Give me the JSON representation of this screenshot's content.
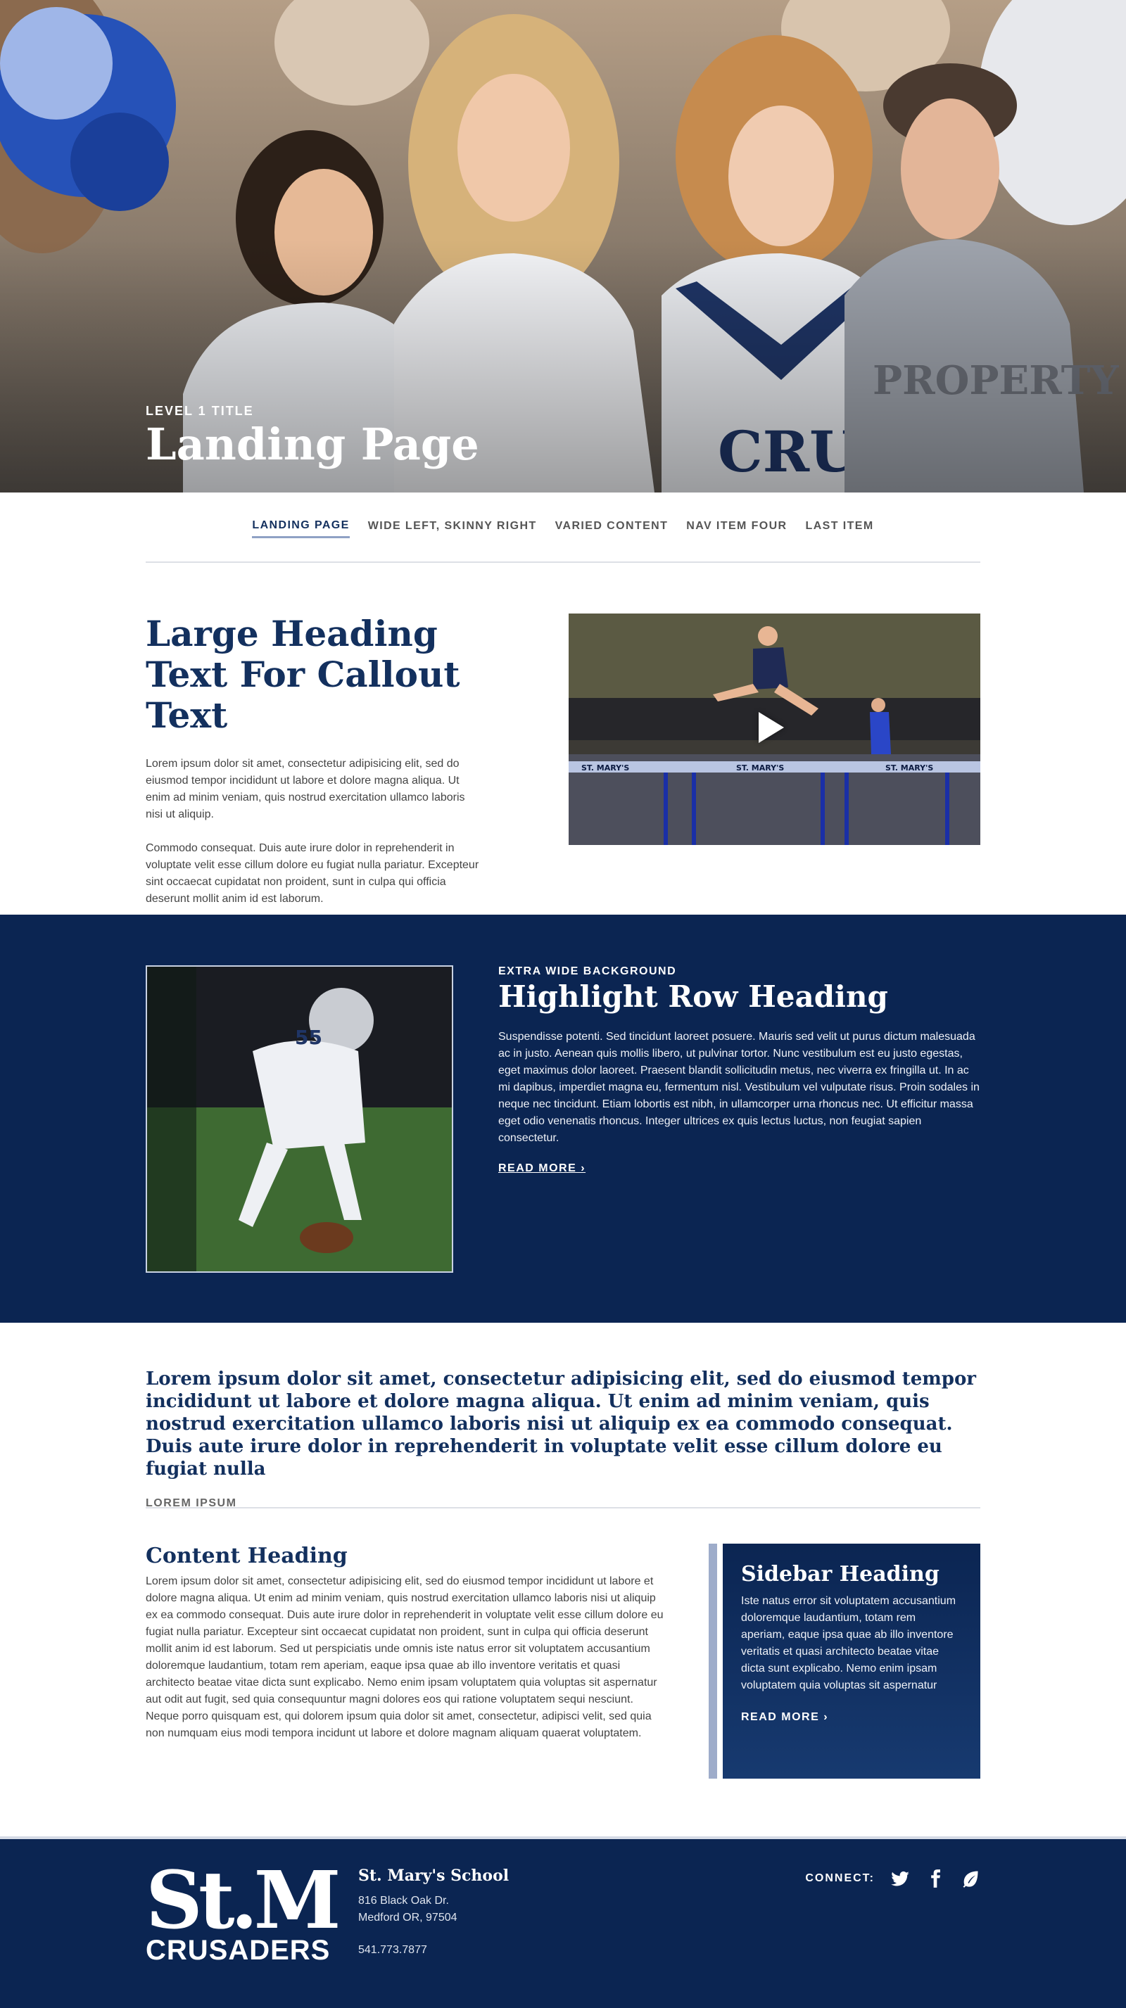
{
  "hero": {
    "eyebrow": "LEVEL 1 TITLE",
    "title": "Landing Page",
    "photo_description_colors": {
      "uniform_navy": "#1f3566",
      "sweatshirt_white": "#eceef2"
    }
  },
  "subnav": {
    "items": [
      {
        "label": "LANDING PAGE",
        "active": true
      },
      {
        "label": "WIDE LEFT, SKINNY RIGHT",
        "active": false
      },
      {
        "label": "VARIED CONTENT",
        "active": false
      },
      {
        "label": "NAV ITEM FOUR",
        "active": false
      },
      {
        "label": "LAST ITEM",
        "active": false
      }
    ]
  },
  "callout": {
    "title": "Large Heading Text For Callout Text",
    "para1": "Lorem ipsum dolor sit amet, consectetur adipisicing elit, sed do eiusmod tempor incididunt ut labore et dolore magna aliqua. Ut enim ad minim veniam, quis nostrud exercitation ullamco laboris nisi ut aliquip.",
    "para2": "Commodo consequat. Duis aute irure dolor in reprehenderit in voluptate velit esse cillum dolore eu fugiat nulla pariatur. Excepteur sint occaecat cupidatat non proident, sunt in culpa qui officia deserunt mollit anim id est laborum.",
    "video_banners": [
      "ST. MARY'S",
      "ST. MARY'S",
      "ST. MARY'S"
    ]
  },
  "highlight": {
    "eyebrow": "EXTRA WIDE BACKGROUND",
    "title": "Highlight Row Heading",
    "body": "Suspendisse potenti. Sed tincidunt laoreet posuere. Mauris sed velit ut purus dictum malesuada ac in justo. Aenean quis mollis libero, ut pulvinar tortor. Nunc vestibulum est eu justo egestas, eget maximus dolor laoreet. Praesent blandit sollicitudin metus, nec viverra ex fringilla ut. In ac mi dapibus, imperdiet magna eu, fermentum nisl. Vestibulum vel vulputate risus. Proin sodales in neque nec tincidunt. Etiam lobortis est nibh, in ullamcorper urna rhoncus nec. Ut efficitur massa eget odio venenatis rhoncus. Integer ultrices ex quis lectus luctus, non feugiat sapien consectetur.",
    "more": "READ MORE ›",
    "jersey_number": "55"
  },
  "quote": {
    "text": "Lorem ipsum dolor sit amet, consectetur adipisicing elit, sed do eiusmod tempor incididunt ut labore et dolore magna aliqua. Ut enim ad minim veniam, quis nostrud exercitation ullamco laboris nisi ut aliquip ex ea commodo consequat. Duis aute irure dolor in reprehenderit in voluptate velit esse cillum dolore eu fugiat nulla",
    "cite": "LOREM IPSUM"
  },
  "content": {
    "title": "Content Heading",
    "body": "Lorem ipsum dolor sit amet, consectetur adipisicing elit, sed do eiusmod tempor incididunt ut labore et dolore magna aliqua. Ut enim ad minim veniam, quis nostrud exercitation ullamco laboris nisi ut aliquip ex ea commodo consequat. Duis aute irure dolor in reprehenderit in voluptate velit esse cillum dolore eu fugiat nulla pariatur. Excepteur sint occaecat cupidatat non proident, sunt in culpa qui officia deserunt mollit anim id est laborum. Sed ut perspiciatis unde omnis iste natus error sit voluptatem accusantium doloremque laudantium, totam rem aperiam, eaque ipsa quae ab illo inventore veritatis et quasi architecto beatae vitae dicta sunt explicabo. Nemo enim ipsam voluptatem quia voluptas sit aspernatur aut odit aut fugit, sed quia consequuntur magni dolores eos qui ratione voluptatem sequi nesciunt. Neque porro quisquam est, qui dolorem ipsum quia dolor sit amet, consectetur, adipisci velit, sed quia non numquam eius modi tempora incidunt ut labore et dolore magnam aliquam quaerat voluptatem."
  },
  "sidebar": {
    "title": "Sidebar Heading",
    "body": "Iste natus error sit voluptatem accusantium doloremque laudantium, totam rem aperiam, eaque ipsa quae ab illo inventore veritatis et quasi architecto beatae vitae dicta sunt explicabo. Nemo enim ipsam voluptatem quia voluptas sit aspernatur",
    "more": "READ MORE ›"
  },
  "footer": {
    "logo_mark": "St.M",
    "logo_word": "CRUSADERS",
    "school_name": "St. Mary's School",
    "address1": "816 Black Oak Dr.",
    "address2": "Medford OR, 97504",
    "phone": "541.773.7877",
    "connect_label": "CONNECT:",
    "social_icons": [
      "twitter-icon",
      "facebook-icon",
      "leaf-icon"
    ]
  },
  "colors": {
    "navy": "#0b2552",
    "heading_blue": "#13305e",
    "active_underline": "#8fa1c4",
    "sidebar_rule": "#9eacca"
  }
}
